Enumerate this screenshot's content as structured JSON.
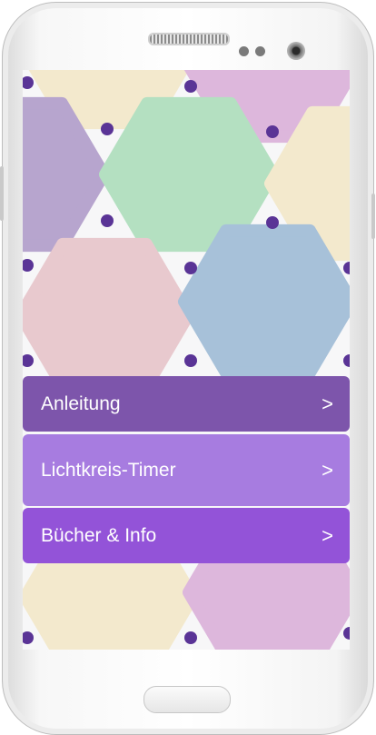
{
  "colors": {
    "menu_1": "#7d55ab",
    "menu_2": "#a77ce0",
    "menu_3": "#9353d8",
    "hex_yellow": "#f3e9cd",
    "hex_pink": "#ddb7dc",
    "hex_lavender": "#b7a5ce",
    "hex_green": "#b4e0c1",
    "hex_rose": "#e8c9ce",
    "hex_blue": "#a7c1d9",
    "dot": "#5a3496"
  },
  "menu": {
    "items": [
      {
        "label": "Anleitung",
        "arrow": ">"
      },
      {
        "label": "Lichtkreis-Timer",
        "arrow": ">"
      },
      {
        "label": "Bücher & Info",
        "arrow": ">"
      }
    ]
  }
}
